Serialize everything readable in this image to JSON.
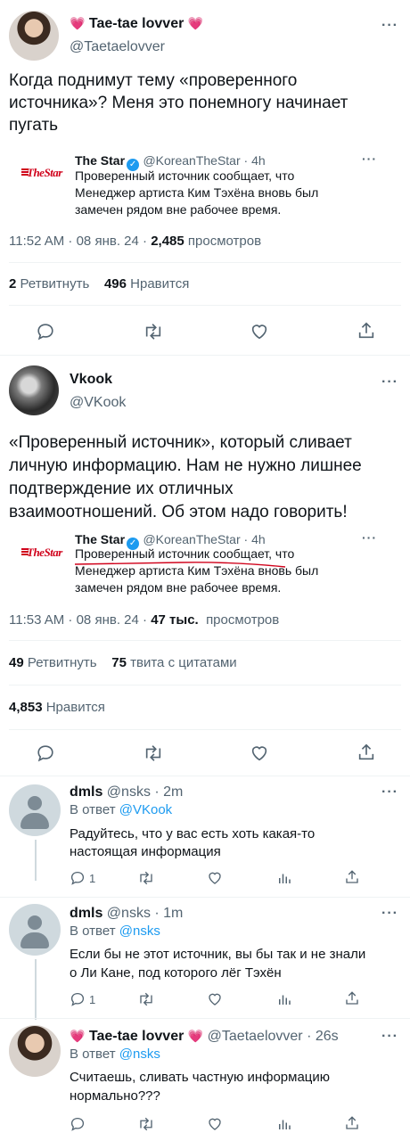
{
  "tweet1": {
    "name": "Tae-tae lovver",
    "heart": "💗",
    "handle": "@Taetaelovver",
    "text_line1": "Когда поднимут тему «проверенного",
    "text_line2": "источника»? Меня это понемногу начинает",
    "text_line3": "пугать",
    "quote": {
      "logo": "TheStar",
      "name": "The Star",
      "handle_time": "@KoreanTheStar · 4h",
      "line1": "Проверенный источник сообщает, что",
      "line2": "Менеджер артиста Ким Тэхёна вновь был",
      "line3": "замечен рядом вне рабочее время."
    },
    "meta_time": "11:52 AM · 08 янв. 24 ·",
    "views_count": "2,485",
    "views_label": "просмотров",
    "retweets_count": "2",
    "retweets_label": "Ретвитнуть",
    "likes_count": "496",
    "likes_label": "Нравится"
  },
  "tweet2": {
    "name": "Vkook",
    "handle": "@VKook",
    "text_line1": "«Проверенный источник», который сливает",
    "text_line2": "личную информацию. Нам не нужно лишнее",
    "text_line3": "подтверждение их отличных",
    "text_line4": "взаимоотношений. Об этом надо говорить!",
    "quote": {
      "logo": "TheStar",
      "name": "The Star",
      "handle_time": "@KoreanTheStar · 4h",
      "line1": "Проверенный источник сообщает, что",
      "line2": "Менеджер артиста Ким Тэхёна вновь был",
      "line3": "замечен рядом вне рабочее время."
    },
    "meta_time": "11:53 AM · 08 янв. 24 ·",
    "views_count": "47 тыс.",
    "views_label": "просмотров",
    "retweets_count": "49",
    "retweets_label": "Ретвитнуть",
    "quotes_count": "75",
    "quotes_label": "твита с цитатами",
    "likes_count": "4,853",
    "likes_label": "Нравится"
  },
  "replies": [
    {
      "name": "dmls",
      "handle_time": "@nsks · 2m",
      "reply_prefix": "В ответ",
      "reply_to": "@VKook",
      "line1": "Радуйтесь, что у вас есть хоть какая-то",
      "line2": "настоящая информация",
      "reply_count": "1"
    },
    {
      "name": "dmls",
      "handle_time": "@nsks · 1m",
      "reply_prefix": "В ответ",
      "reply_to": "@nsks",
      "line1": "Если бы не этот источник, вы бы так и не знали",
      "line2": "о Ли Кане, под которого лёг Тэхён",
      "reply_count": "1"
    },
    {
      "name": "Tae-tae lovver",
      "heart": "💗",
      "handle_time": "@Taetaelovver · 26s",
      "reply_prefix": "В ответ",
      "reply_to": "@nsks",
      "line1": "Считаешь, сливать частную информацию",
      "line2": "нормально???"
    }
  ],
  "icons": {
    "more": "more-icon",
    "reply": "reply-icon",
    "retweet": "retweet-icon",
    "like": "like-icon",
    "share": "share-icon",
    "analytics": "analytics-icon"
  },
  "colors": {
    "accent": "#1d9bf0",
    "text": "#0f1419",
    "muted": "#536471",
    "star_red": "#d0021b",
    "heart_pink": "#f25f9a"
  }
}
